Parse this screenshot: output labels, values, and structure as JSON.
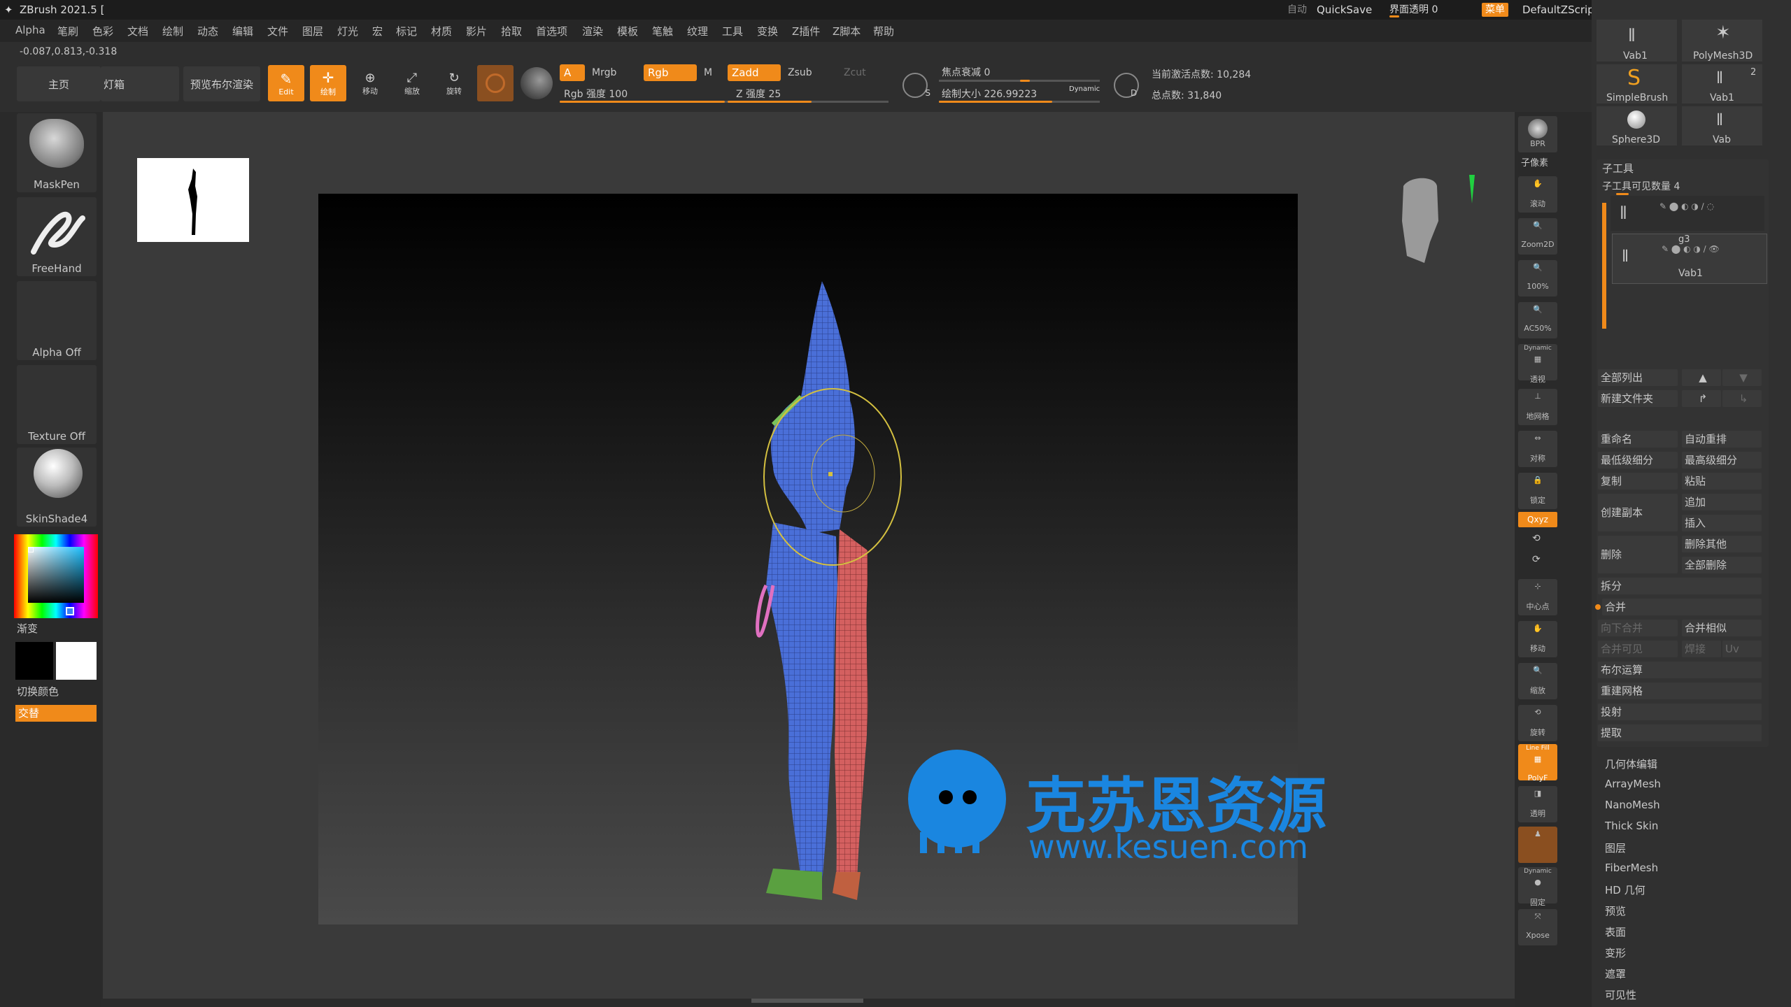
{
  "title": {
    "app": "ZBrush 2021.5 [",
    "auto": "自动",
    "quicksave": "QuickSave",
    "interface_opacity": "界面透明 0",
    "menu_btn": "菜单",
    "script": "DefaultZScript"
  },
  "menu": [
    "Alpha",
    "笔刷",
    "色彩",
    "文档",
    "绘制",
    "动态",
    "编辑",
    "文件",
    "图层",
    "灯光",
    "宏",
    "标记",
    "材质",
    "影片",
    "拾取",
    "首选项",
    "渲染",
    "模板",
    "笔触",
    "纹理",
    "工具",
    "变换",
    "Z插件",
    "Z脚本",
    "帮助"
  ],
  "coords": "-0.087,0.813,-0.318",
  "toolbar": {
    "home": "主页",
    "lightbox": "灯箱",
    "preview_bool": "预览布尔渲染",
    "edit": "Edit",
    "draw": "绘制",
    "move": "移动",
    "scale": "缩放",
    "rotate": "旋转",
    "a": "A",
    "mrgb": "Mrgb",
    "rgb": "Rgb",
    "m": "M",
    "rgb_intensity": "Rgb 强度 100",
    "zadd": "Zadd",
    "zsub": "Zsub",
    "zcut": "Zcut",
    "z_intensity": "Z 强度 25",
    "focal": "焦点衰减 0",
    "draw_size": "绘制大小 226.99223",
    "dynamic": "Dynamic",
    "active_points": "当前激活点数: 10,284",
    "total_points": "总点数: 31,840",
    "s": "S",
    "d": "D"
  },
  "left": {
    "maskpen": "MaskPen",
    "freehand": "FreeHand",
    "alpha": "Alpha Off",
    "texture": "Texture Off",
    "material": "SkinShade4",
    "gradient": "渐变",
    "switch_color": "切换颜色",
    "alternate": "交替"
  },
  "right_shelf": [
    "BPR",
    "子像素",
    "滚动",
    "Zoom2D",
    "100%",
    "AC50%",
    "Dynamic",
    "透视",
    "地网格",
    "对称",
    "锁定",
    "Qxyz",
    "中心点",
    "移动",
    "缩放",
    "旋转",
    "Line Fill",
    "PolyF",
    "透明",
    "Dynamic",
    "固定",
    "Xpose"
  ],
  "panel": {
    "tools": [
      "Vab1",
      "PolyMesh3D",
      "SimpleBrush",
      "Vab1",
      "Sphere3D",
      "Vab"
    ],
    "tool_count": "2",
    "subtool_title": "子工具",
    "subtool_visible": "子工具可见数量 4",
    "g3": "g3",
    "vab1": "Vab1",
    "list_all": "全部列出",
    "new_folder": "新建文件夹",
    "rename": "重命名",
    "auto_reorder": "自动重排",
    "lowest_sub": "最低级细分",
    "highest_sub": "最高级细分",
    "copy": "复制",
    "paste": "粘贴",
    "create_copy": "创建副本",
    "append": "追加",
    "insert": "插入",
    "delete": "删除",
    "delete_other": "删除其他",
    "delete_all": "全部删除",
    "split": "拆分",
    "merge": "合并",
    "merge_down": "向下合并",
    "merge_similar": "合并相似",
    "merge_visible": "合并可见",
    "weld": "焊接",
    "uv": "Uv",
    "boolean": "布尔运算",
    "remesh": "重建网格",
    "project": "投射",
    "extract": "提取",
    "sections": [
      "几何体编辑",
      "ArrayMesh",
      "NanoMesh",
      "Thick Skin",
      "图层",
      "FiberMesh",
      "HD 几何",
      "预览",
      "表面",
      "变形",
      "遮罩",
      "可见性"
    ]
  },
  "watermark": {
    "title": "克苏恩资源",
    "url": "www.kesuen.com"
  }
}
